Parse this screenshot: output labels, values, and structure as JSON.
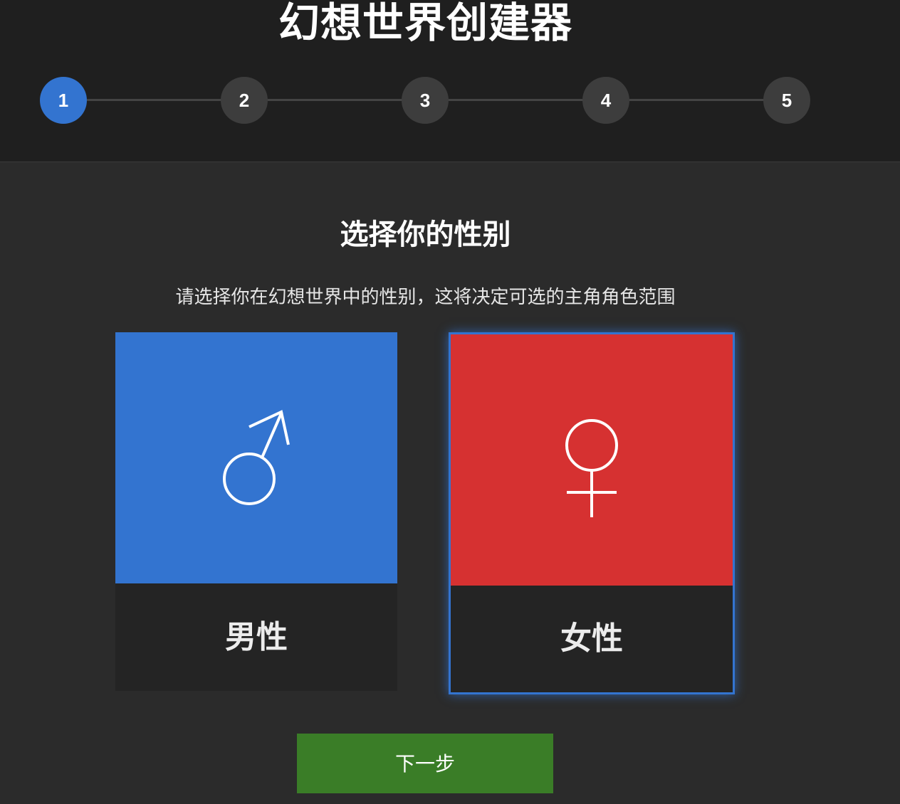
{
  "app": {
    "title": "幻想世界创建器"
  },
  "stepper": {
    "steps": [
      "1",
      "2",
      "3",
      "4",
      "5"
    ],
    "current_step": 1,
    "active_color": "#3374d0",
    "inactive_color": "#3d3d3d"
  },
  "section": {
    "title": "选择你的性别",
    "description": "请选择你在幻想世界中的性别，这将决定可选的主角角色范围"
  },
  "options": {
    "male": {
      "label": "男性",
      "icon": "male-symbol-icon",
      "color": "#3374d0"
    },
    "female": {
      "label": "女性",
      "icon": "female-symbol-icon",
      "color": "#d63131",
      "selected": true
    }
  },
  "footer": {
    "next_label": "下一步",
    "next_color": "#3a7d27"
  }
}
